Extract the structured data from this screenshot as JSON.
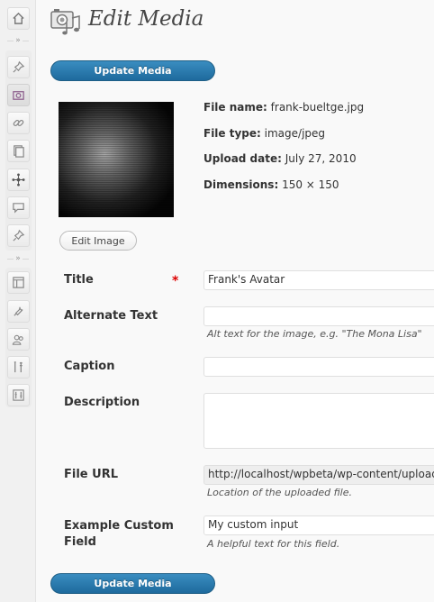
{
  "header": {
    "title": "Edit Media"
  },
  "buttons": {
    "update_media": "Update Media",
    "edit_image": "Edit Image"
  },
  "file_info": {
    "file_name_label": "File name:",
    "file_name": "frank-bueltge.jpg",
    "file_type_label": "File type:",
    "file_type": "image/jpeg",
    "upload_date_label": "Upload date:",
    "upload_date": "July 27, 2010",
    "dimensions_label": "Dimensions:",
    "dimensions": "150 × 150"
  },
  "form": {
    "title_label": "Title",
    "required_mark": "*",
    "title_value": "Frank's Avatar",
    "alt_label": "Alternate Text",
    "alt_value": "",
    "alt_help": "Alt text for the image, e.g. \"The Mona Lisa\"",
    "caption_label": "Caption",
    "caption_value": "",
    "description_label": "Description",
    "description_value": "",
    "file_url_label": "File URL",
    "file_url_value": "http://localhost/wpbeta/wp-content/uploads/frank-bueltge.jpg",
    "file_url_help": "Location of the uploaded file.",
    "custom_label_line1": "Example Custom",
    "custom_label_line2": "Field",
    "custom_value": "My custom input",
    "custom_help": "A helpful text for this field."
  },
  "sidebar": {
    "items": [
      {
        "icon": "dashboard-icon"
      },
      {
        "icon": "pin-icon"
      },
      {
        "icon": "media-icon"
      },
      {
        "icon": "link-icon"
      },
      {
        "icon": "pages-icon"
      },
      {
        "icon": "network-icon"
      },
      {
        "icon": "comments-icon"
      },
      {
        "icon": "pin-icon"
      },
      {
        "icon": "appearance-icon"
      },
      {
        "icon": "plugins-icon"
      },
      {
        "icon": "users-icon"
      },
      {
        "icon": "tools-icon"
      },
      {
        "icon": "settings-icon"
      }
    ],
    "separator_glyph": "»"
  },
  "colors": {
    "primary_button": "#2a7db5",
    "required": "#dd0000"
  }
}
